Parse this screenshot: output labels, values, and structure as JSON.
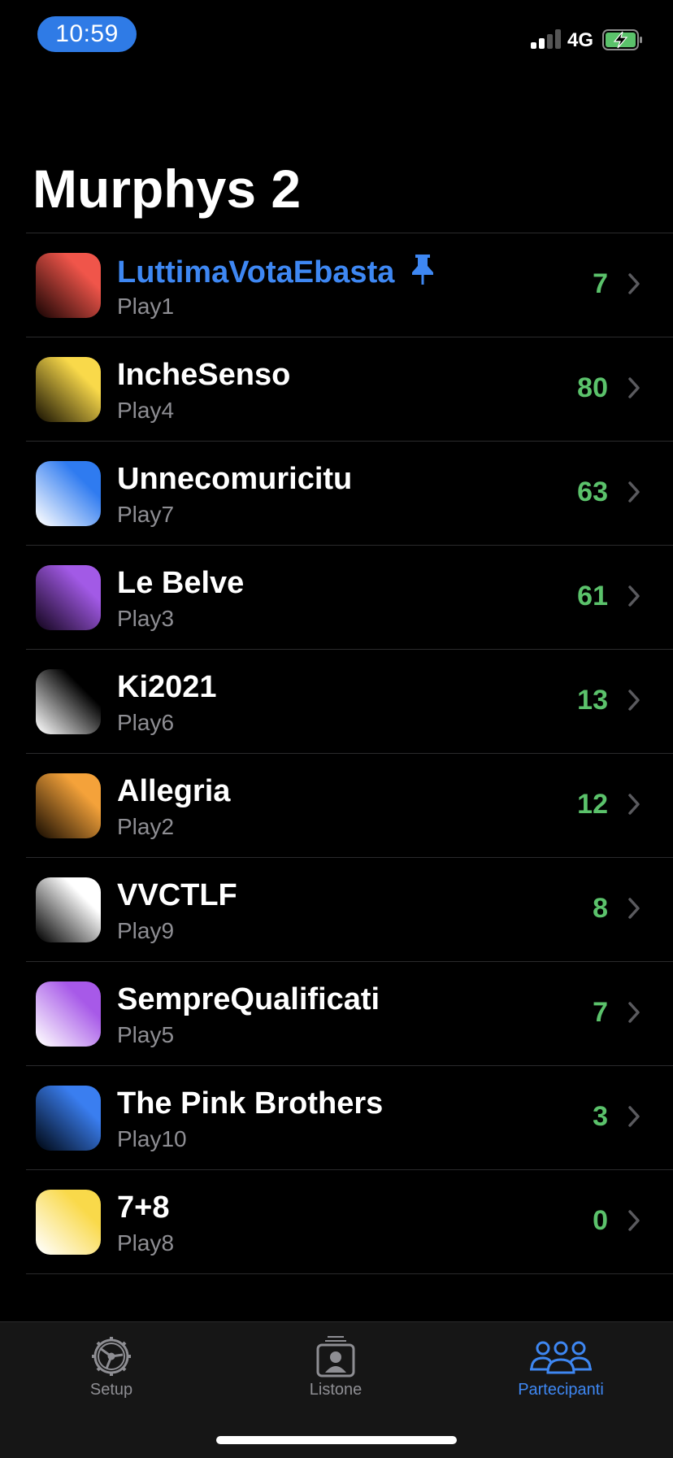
{
  "status_bar": {
    "time": "10:59",
    "network": "4G",
    "signal_bars_active": 2,
    "battery": "charging"
  },
  "page": {
    "title": "Murphys 2"
  },
  "list": {
    "items": [
      {
        "name": "LuttimaVotaEbasta",
        "player": "Play1",
        "score": "7",
        "pinned": true,
        "color_top": "#f0554a",
        "color_bottom": "#1a0504"
      },
      {
        "name": "IncheSenso",
        "player": "Play4",
        "score": "80",
        "pinned": false,
        "color_top": "#f9d94a",
        "color_bottom": "#1a1403"
      },
      {
        "name": "Unnecomuricitu",
        "player": "Play7",
        "score": "63",
        "pinned": false,
        "color_top": "#2f7bf0",
        "color_bottom": "#ffffff"
      },
      {
        "name": "Le Belve",
        "player": "Play3",
        "score": "61",
        "pinned": false,
        "color_top": "#a25ae6",
        "color_bottom": "#150620"
      },
      {
        "name": "Ki2021",
        "player": "Play6",
        "score": "13",
        "pinned": false,
        "color_top": "#000000",
        "color_bottom": "#ffffff"
      },
      {
        "name": "Allegria",
        "player": "Play2",
        "score": "12",
        "pinned": false,
        "color_top": "#f4a23a",
        "color_bottom": "#1a0e02"
      },
      {
        "name": "VVCTLF",
        "player": "Play9",
        "score": "8",
        "pinned": false,
        "color_top": "#ffffff",
        "color_bottom": "#000000"
      },
      {
        "name": "SempreQualificati",
        "player": "Play5",
        "score": "7",
        "pinned": false,
        "color_top": "#a759e8",
        "color_bottom": "#ffffff"
      },
      {
        "name": "The Pink Brothers",
        "player": "Play10",
        "score": "3",
        "pinned": false,
        "color_top": "#3a7ef0",
        "color_bottom": "#000814"
      },
      {
        "name": "7+8",
        "player": "Play8",
        "score": "0",
        "pinned": false,
        "color_top": "#f9d94a",
        "color_bottom": "#ffffff"
      }
    ]
  },
  "tab_bar": {
    "tabs": [
      {
        "label": "Setup",
        "icon": "gear-icon",
        "active": false
      },
      {
        "label": "Listone",
        "icon": "contacts-icon",
        "active": false
      },
      {
        "label": "Partecipanti",
        "icon": "group-icon",
        "active": true
      }
    ]
  },
  "colors": {
    "accent": "#3e87f2",
    "score": "#5bc26b",
    "secondary_text": "#8e8e93"
  }
}
